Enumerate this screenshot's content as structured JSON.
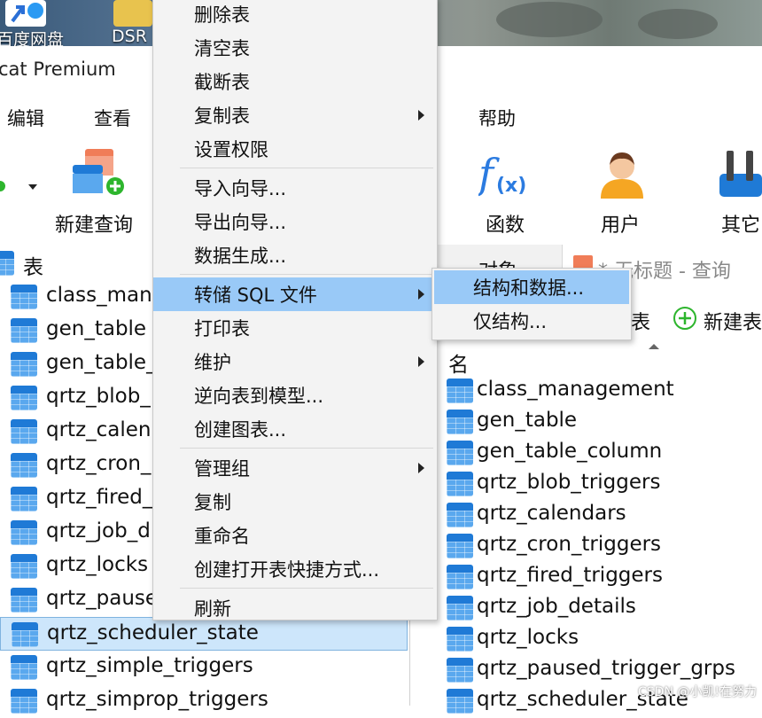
{
  "desktop": {
    "icons": [
      {
        "label": "百度网盘",
        "icon": "baidu-netdisk-icon"
      },
      {
        "label": "DSR",
        "icon": "folder-icon"
      }
    ]
  },
  "window": {
    "title": "cat Premium"
  },
  "menubar": {
    "items": [
      "编辑",
      "查看",
      "帮助"
    ]
  },
  "toolbar": {
    "buttons": [
      {
        "label": "新建查询",
        "icon": "new-query-icon"
      },
      {
        "label": "函数",
        "icon": "function-icon"
      },
      {
        "label": "用户",
        "icon": "user-icon"
      },
      {
        "label": "其它",
        "icon": "tools-icon"
      }
    ]
  },
  "tree": {
    "header": "表",
    "items": [
      "class_mana",
      "gen_table",
      "gen_table_",
      "qrtz_blob_",
      "qrtz_calen",
      "qrtz_cron_",
      "qrtz_fired_",
      "qrtz_job_d",
      "qrtz_locks",
      "qrtz_pause",
      "qrtz_scheduler_state",
      "qrtz_simple_triggers",
      "qrtz_simprop_triggers"
    ],
    "selected_index": 10
  },
  "tabs": {
    "objects": "对象",
    "query_tab": "* 无标题 - 查询"
  },
  "object_toolbar": {
    "open_table_suffix": "表",
    "new_table": "新建表"
  },
  "object_list": {
    "column_header": "名",
    "items": [
      "class_management",
      "gen_table",
      "gen_table_column",
      "qrtz_blob_triggers",
      "qrtz_calendars",
      "qrtz_cron_triggers",
      "qrtz_fired_triggers",
      "qrtz_job_details",
      "qrtz_locks",
      "qrtz_paused_trigger_grps",
      "qrtz_scheduler_state"
    ]
  },
  "context_menu": {
    "items": [
      {
        "label": "删除表",
        "submenu": false
      },
      {
        "label": "清空表",
        "submenu": false
      },
      {
        "label": "截断表",
        "submenu": false
      },
      {
        "label": "复制表",
        "submenu": true
      },
      {
        "label": "设置权限",
        "submenu": false
      },
      {
        "label": "导入向导...",
        "submenu": false
      },
      {
        "label": "导出向导...",
        "submenu": false
      },
      {
        "label": "数据生成...",
        "submenu": false
      },
      {
        "label": "转储 SQL 文件",
        "submenu": true,
        "highlighted": true
      },
      {
        "label": "打印表",
        "submenu": false
      },
      {
        "label": "维护",
        "submenu": true
      },
      {
        "label": "逆向表到模型...",
        "submenu": false
      },
      {
        "label": "创建图表...",
        "submenu": false
      },
      {
        "label": "管理组",
        "submenu": true
      },
      {
        "label": "复制",
        "submenu": false
      },
      {
        "label": "重命名",
        "submenu": false
      },
      {
        "label": "创建打开表快捷方式...",
        "submenu": false
      },
      {
        "label": "刷新",
        "submenu": false
      }
    ]
  },
  "submenu": {
    "items": [
      {
        "label": "结构和数据...",
        "highlighted": true
      },
      {
        "label": "仅结构..."
      }
    ]
  },
  "watermark": "CSDN @小凯!在努力",
  "colors": {
    "highlight": "#99c9f7",
    "selected_row": "#cde6fb",
    "table_icon": "#1f7ad6",
    "add_green": "#2db52d"
  }
}
